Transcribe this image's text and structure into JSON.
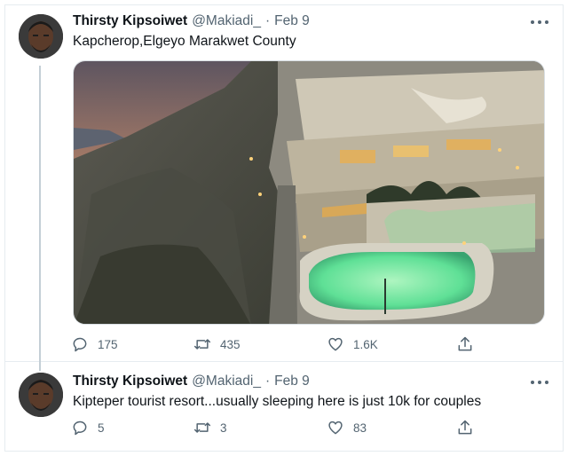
{
  "tweets": [
    {
      "name": "Thirsty Kipsoiwet",
      "handle": "@Makiadi_",
      "date": "Feb 9",
      "text": "Kapcherop,Elgeyo Marakwet County",
      "stats": {
        "replies": "175",
        "retweets": "435",
        "likes": "1.6K"
      }
    },
    {
      "name": "Thirsty Kipsoiwet",
      "handle": "@Makiadi_",
      "date": "Feb 9",
      "text": "Kipteper tourist resort...usually sleeping here is just 10k for couples",
      "stats": {
        "replies": "5",
        "retweets": "3",
        "likes": "83"
      }
    }
  ],
  "separator": "·",
  "colors": {
    "text": "#0f1419",
    "muted": "#536471",
    "border": "#e6ecf0",
    "thread": "#c4cfd6"
  },
  "icons": [
    "more-icon",
    "reply-icon",
    "retweet-icon",
    "like-icon",
    "share-icon"
  ]
}
